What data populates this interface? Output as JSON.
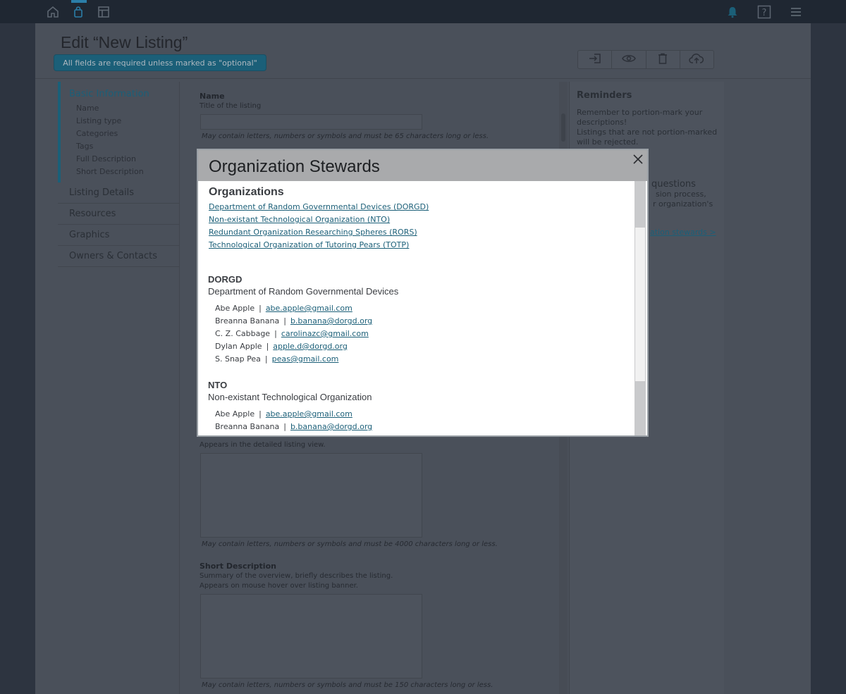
{
  "page": {
    "title": "Edit “New Listing”",
    "required_notice": "All fields are required unless marked as \"optional\""
  },
  "left_nav": {
    "active_section": "Basic Information",
    "sub_items": [
      "Name",
      "Listing type",
      "Categories",
      "Tags",
      "Full Description",
      "Short Description"
    ],
    "sections": [
      "Listing Details",
      "Resources",
      "Graphics",
      "Owners & Contacts"
    ]
  },
  "form": {
    "name": {
      "label": "Name",
      "desc": "Title of the listing",
      "hint": "May contain letters, numbers or symbols and must be 65 characters long or less."
    },
    "full_description": {
      "desc_partial": "Appears in the detailed listing view.",
      "hint": "May contain letters, numbers or symbols and must be 4000 characters long or less."
    },
    "short_description": {
      "label": "Short Description",
      "desc1": "Summary of the overview, briefly describes the listing.",
      "desc2": "Appears on mouse hover over listing banner.",
      "hint": "May contain letters, numbers or symbols and must be 150 characters long or less."
    }
  },
  "reminders": {
    "title": "Reminders",
    "text1": "Remember to portion-mark your descriptions!",
    "text2": "Listings that are not portion-marked will be rejected.",
    "partial_heading": "questions",
    "partial_line1": "sion process,",
    "partial_line2": "r organization's",
    "partial_link": "ation stewards >"
  },
  "modal": {
    "title": "Organization Stewards",
    "organizations_heading": "Organizations",
    "org_links": [
      "Department of Random Governmental Devices (DORGD)",
      "Non-existant Technological Organization (NTO)",
      "Redundant Organization Researching Spheres  (RORS)",
      "Technological Organization of Tutoring Pears (TOTP)"
    ],
    "groups": [
      {
        "abbr": "DORGD",
        "full": "Department of Random Governmental Devices",
        "stewards": [
          {
            "name": "Abe Apple",
            "email": "abe.apple@gmail.com"
          },
          {
            "name": "Breanna Banana",
            "email": "b.banana@dorgd.org"
          },
          {
            "name": "C. Z. Cabbage",
            "email": "carolinazc@gmail.com"
          },
          {
            "name": "Dylan Apple",
            "email": "apple.d@dorgd.org"
          },
          {
            "name": "S. Snap Pea",
            "email": "peas@gmail.com"
          }
        ]
      },
      {
        "abbr": "NTO",
        "full": "Non-existant Technological Organization",
        "stewards": [
          {
            "name": "Abe Apple",
            "email": "abe.apple@gmail.com"
          },
          {
            "name": "Breanna Banana",
            "email": "b.banana@dorgd.org"
          }
        ]
      }
    ]
  },
  "colors": {
    "accent": "#1b5f78",
    "topbar": "#1f2732",
    "overlay_page": "#4a505a"
  },
  "icons": {
    "topbar": [
      "home-icon",
      "shopping-bag-icon",
      "layout-icon",
      "bell-icon",
      "help-icon",
      "hamburger-menu-icon"
    ],
    "actions": [
      "submit-icon",
      "preview-icon",
      "delete-icon",
      "upload-icon"
    ]
  }
}
